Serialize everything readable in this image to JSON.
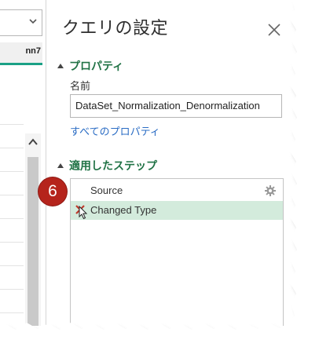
{
  "left_grid": {
    "column_header": "nn7",
    "dropdown_icon": "chevron-down-icon",
    "scroll_up_icon": "chevron-up-icon"
  },
  "pane": {
    "title": "クエリの設定",
    "close_icon": "close-icon"
  },
  "properties": {
    "section_title": "プロパティ",
    "name_label": "名前",
    "name_value": "DataSet_Normalization_Denormalization",
    "all_properties_link": "すべてのプロパティ"
  },
  "applied_steps": {
    "section_title": "適用したステップ",
    "steps": [
      {
        "label": "Source",
        "icon": "gear-icon",
        "selected": false
      },
      {
        "label": "Changed Type",
        "icon": "delete-icon",
        "selected": true
      }
    ]
  },
  "callout": {
    "number": "6",
    "color": "#b5241c"
  },
  "colors": {
    "accent_teal": "#1aa186",
    "section_green": "#217346",
    "link_blue": "#2a6cc4",
    "selected_step_bg": "#d3ebdc"
  }
}
